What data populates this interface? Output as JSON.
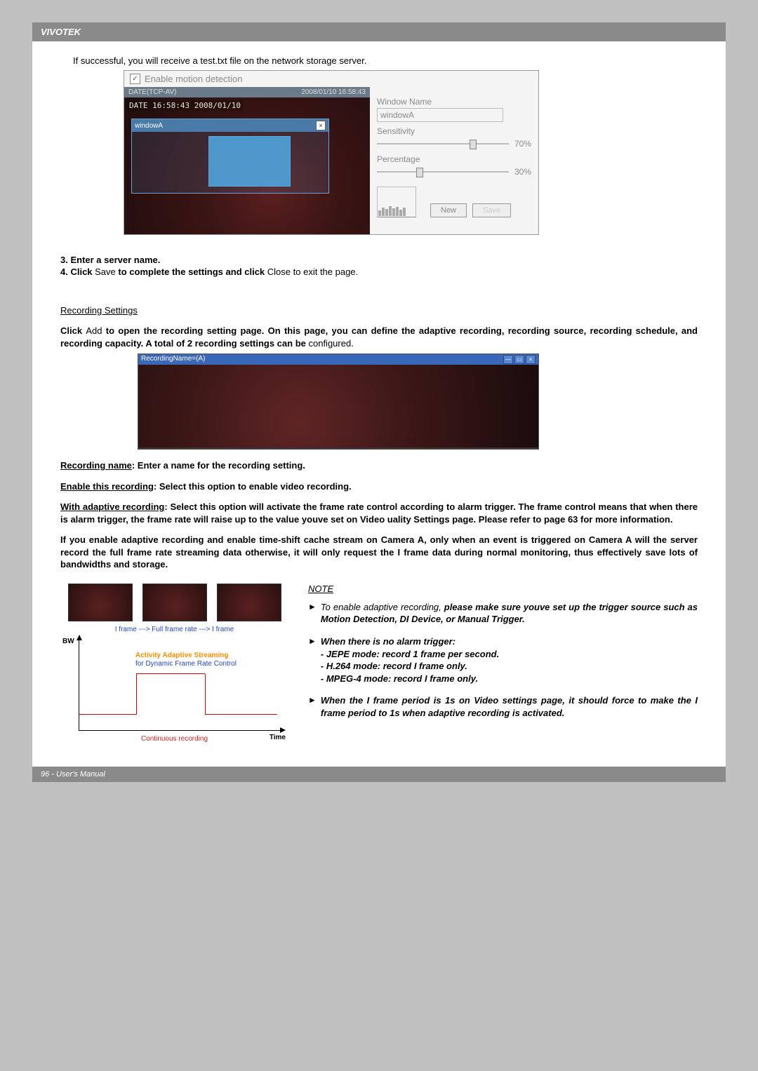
{
  "header": {
    "brand": "VIVOTEK"
  },
  "intro": "If successful, you will receive a test.txt file on the network storage server.",
  "motion": {
    "enable_label": "Enable motion detection",
    "title_left": "DATE(TCP-AV)",
    "title_right": "2008/01/10 16:58:43",
    "timestamp_overlay": "DATE 16:58:43 2008/01/10",
    "window_box_title": "windowA",
    "label_window_name": "Window Name",
    "input_window_name": "windowA",
    "label_sensitivity": "Sensitivity",
    "sensitivity_value": "70%",
    "label_percentage": "Percentage",
    "percentage_value": "30%",
    "btn_new": "New",
    "btn_save": "Save"
  },
  "steps": {
    "s3": "3. Enter a server name.",
    "s4_a": "4. Click ",
    "s4_save": "Save",
    "s4_b": " to complete the settings and click ",
    "s4_close": "Close",
    "s4_c": " to exit the page."
  },
  "rec_settings": {
    "title": "Recording Settings",
    "p1_a": "Click ",
    "p1_add": "Add",
    "p1_b": " to open the recording setting page. On this page, you can define the adaptive recording, recording source, recording schedule, and recording capacity. A total of 2 recording settings can be ",
    "p1_c": "configured.",
    "bar_title": "RecordingName=(A)"
  },
  "params": {
    "name_l": "Recording name",
    "name_t": ": Enter a name for the recording setting.",
    "enable_l": "Enable this recording",
    "enable_t": ": Select this option to enable video recording.",
    "adapt_l": "With adaptive recording",
    "adapt_t": ": Select this option will activate the frame rate control according to alarm trigger. The frame control means that when there is alarm trigger, the frame rate will raise up to the value youve set on Video uality Settings page. Please refer to page 63 for more information.",
    "adapt2": "If you enable adaptive recording and enable time-shift cache stream on Camera A, only when an event is triggered on Camera A will the server record the full frame rate streaming data otherwise, it will only request the I frame data during normal monitoring, thus effectively save lots of bandwidths and storage."
  },
  "diagram": {
    "flow": "I frame   --->   Full frame rate   --->   I frame",
    "bw": "BW",
    "time": "Time",
    "act1": "Activity Adaptive Streaming",
    "act2": "for Dynamic Frame Rate Control",
    "cont": "Continuous recording"
  },
  "note": {
    "title": "NOTE",
    "n1_a": "To enable adaptive recording, ",
    "n1_b": "please make sure youve set up the trigger source such as Motion Detection, DI Device, or Manual Trigger.",
    "n2_h": "When there is no alarm trigger:",
    "n2_a": "- JEPE mode: record 1 frame per second.",
    "n2_b": "- H.264 mode: record I frame only.",
    "n2_c": "- MPEG-4 mode: record I frame only.",
    "n3": "When the I frame period is 1s on Video settings page, it should force to make the I frame period to 1s when adaptive recording is activated."
  },
  "footer": {
    "text": "96 - User's Manual"
  }
}
